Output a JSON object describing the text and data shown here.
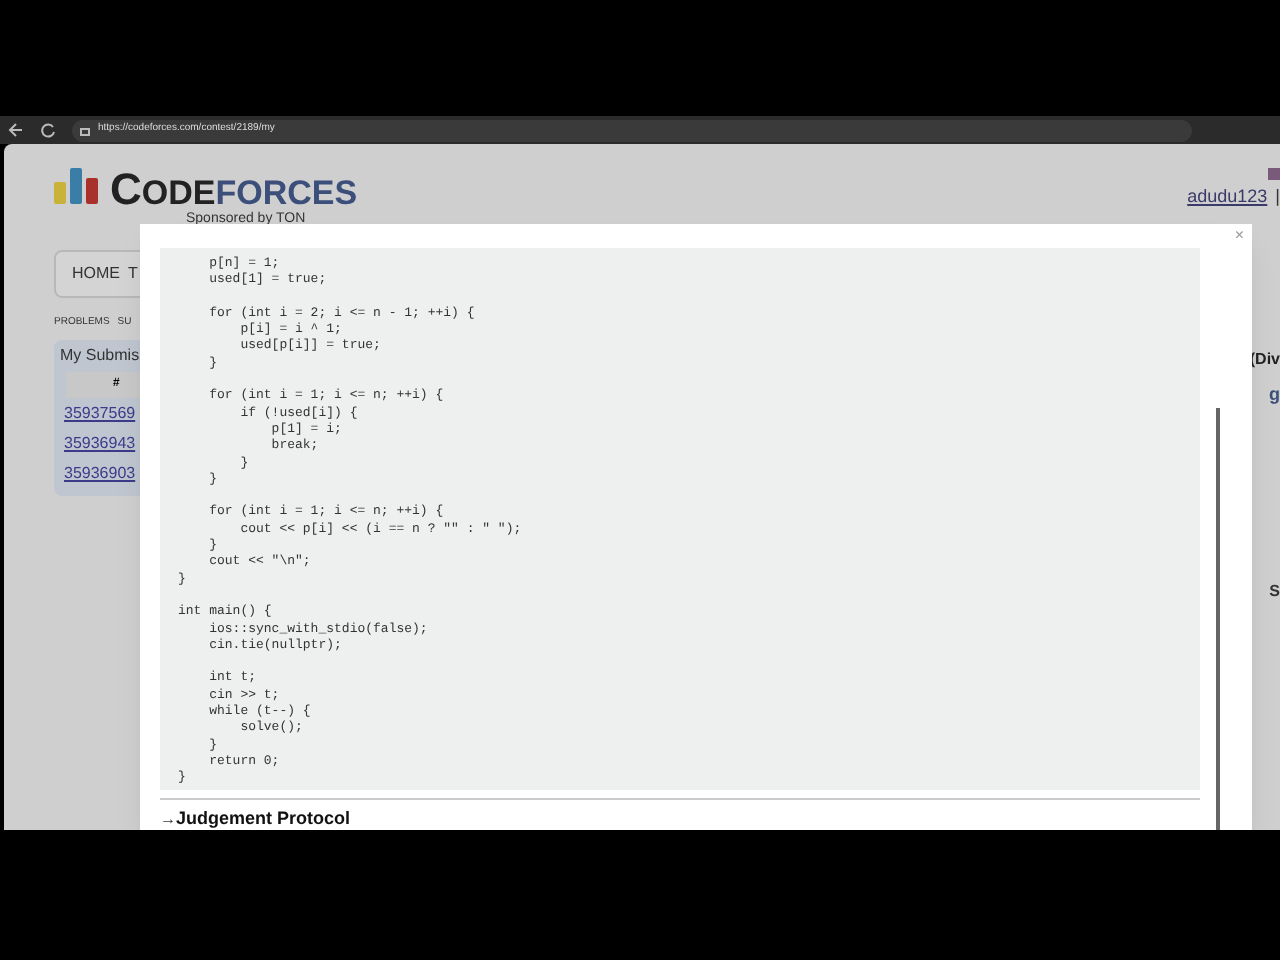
{
  "browser": {
    "url": "https://codeforces.com/contest/2189/my"
  },
  "page": {
    "logo": {
      "first": "C",
      "rest_dark": "ODE",
      "rest_blue": "FORCES"
    },
    "sponsor": "Sponsored by TON",
    "user": "adudu123",
    "user_sep": "|",
    "nav": [
      "HOME",
      "T"
    ],
    "subnav": [
      "PROBLEMS",
      "SU"
    ],
    "submissions": {
      "title": "My Submis",
      "column_1": "#",
      "rows": [
        "35937569",
        "35936943",
        "35936903"
      ]
    },
    "right_texts": [
      "(Div",
      "g",
      "S"
    ]
  },
  "modal": {
    "close": "×",
    "code": "    p[n] = 1;\n    used[1] = true;\n\n    for (int i = 2; i <= n - 1; ++i) {\n        p[i] = i ^ 1;\n        used[p[i]] = true;\n    }\n\n    for (int i = 1; i <= n; ++i) {\n        if (!used[i]) {\n            p[1] = i;\n            break;\n        }\n    }\n\n    for (int i = 1; i <= n; ++i) {\n        cout << p[i] << (i == n ? \"\" : \" \");\n    }\n    cout << \"\\n\";\n}\n\nint main() {\n    ios::sync_with_stdio(false);\n    cin.tie(nullptr);\n\n    int t;\n    cin >> t;\n    while (t--) {\n        solve();\n    }\n    return 0;\n}",
    "section_arrow": "→",
    "section": "Judgement Protocol"
  }
}
